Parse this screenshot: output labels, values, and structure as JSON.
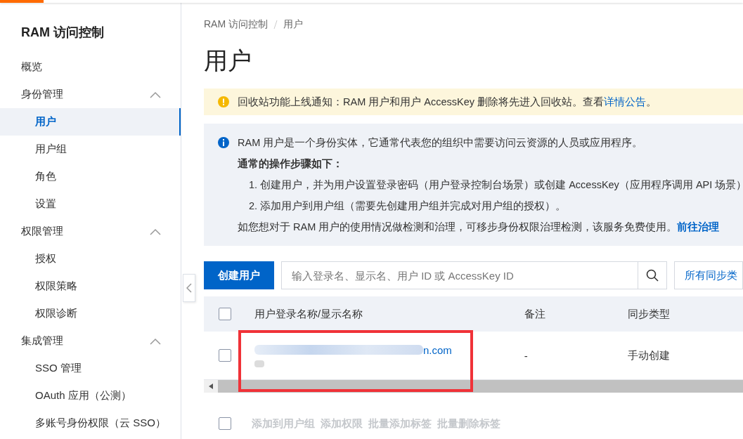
{
  "sidebar": {
    "title": "RAM 访问控制",
    "items": [
      {
        "kind": "link",
        "label": "概览",
        "selected": false
      },
      {
        "kind": "group",
        "label": "身份管理",
        "expanded": true,
        "children": [
          {
            "label": "用户",
            "selected": true
          },
          {
            "label": "用户组",
            "selected": false
          },
          {
            "label": "角色",
            "selected": false
          },
          {
            "label": "设置",
            "selected": false
          }
        ]
      },
      {
        "kind": "group",
        "label": "权限管理",
        "expanded": true,
        "children": [
          {
            "label": "授权",
            "selected": false
          },
          {
            "label": "权限策略",
            "selected": false
          },
          {
            "label": "权限诊断",
            "selected": false
          }
        ]
      },
      {
        "kind": "group",
        "label": "集成管理",
        "expanded": true,
        "children": [
          {
            "label": "SSO 管理",
            "selected": false
          },
          {
            "label": "OAuth 应用（公测）",
            "selected": false
          },
          {
            "label": "多账号身份权限（云 SSO）",
            "selected": false
          }
        ]
      }
    ]
  },
  "breadcrumb": [
    "RAM 访问控制",
    "用户"
  ],
  "page_title": "用户",
  "notice": {
    "text": "回收站功能上线通知：RAM 用户和用户 AccessKey 删除将先进入回收站。查看",
    "link": "详情公告",
    "suffix": "。"
  },
  "info": {
    "intro": "RAM 用户是一个身份实体，它通常代表您的组织中需要访问云资源的人员或应用程序。",
    "steps_title": "通常的操作步骤如下：",
    "steps": [
      "1. 创建用户，并为用户设置登录密码（用户登录控制台场景）或创建 AccessKey（应用程序调用 API 场景）",
      "2. 添加用户到用户组（需要先创建用户组并完成对用户组的授权）。"
    ],
    "footer": "如您想对于 RAM 用户的使用情况做检测和治理，可移步身份权限治理检测，该服务免费使用。",
    "footer_link": "前往治理"
  },
  "toolbar": {
    "create_button": "创建用户",
    "search": {
      "placeholder": "输入登录名、显示名、用户 ID 或 AccessKey ID"
    },
    "filter": "所有同步类"
  },
  "table": {
    "select_all_checked": false,
    "columns": [
      "用户登录名称/显示名称",
      "备注",
      "同步类型"
    ],
    "rows": [
      {
        "checked": false,
        "login_name": "n.com",
        "note": "-",
        "sync_type": "手动创建"
      }
    ]
  },
  "batch_actions": {
    "checked": false,
    "disabled": true,
    "actions": [
      "添加到用户组",
      "添加权限",
      "批量添加标签",
      "批量删除标签"
    ]
  }
}
